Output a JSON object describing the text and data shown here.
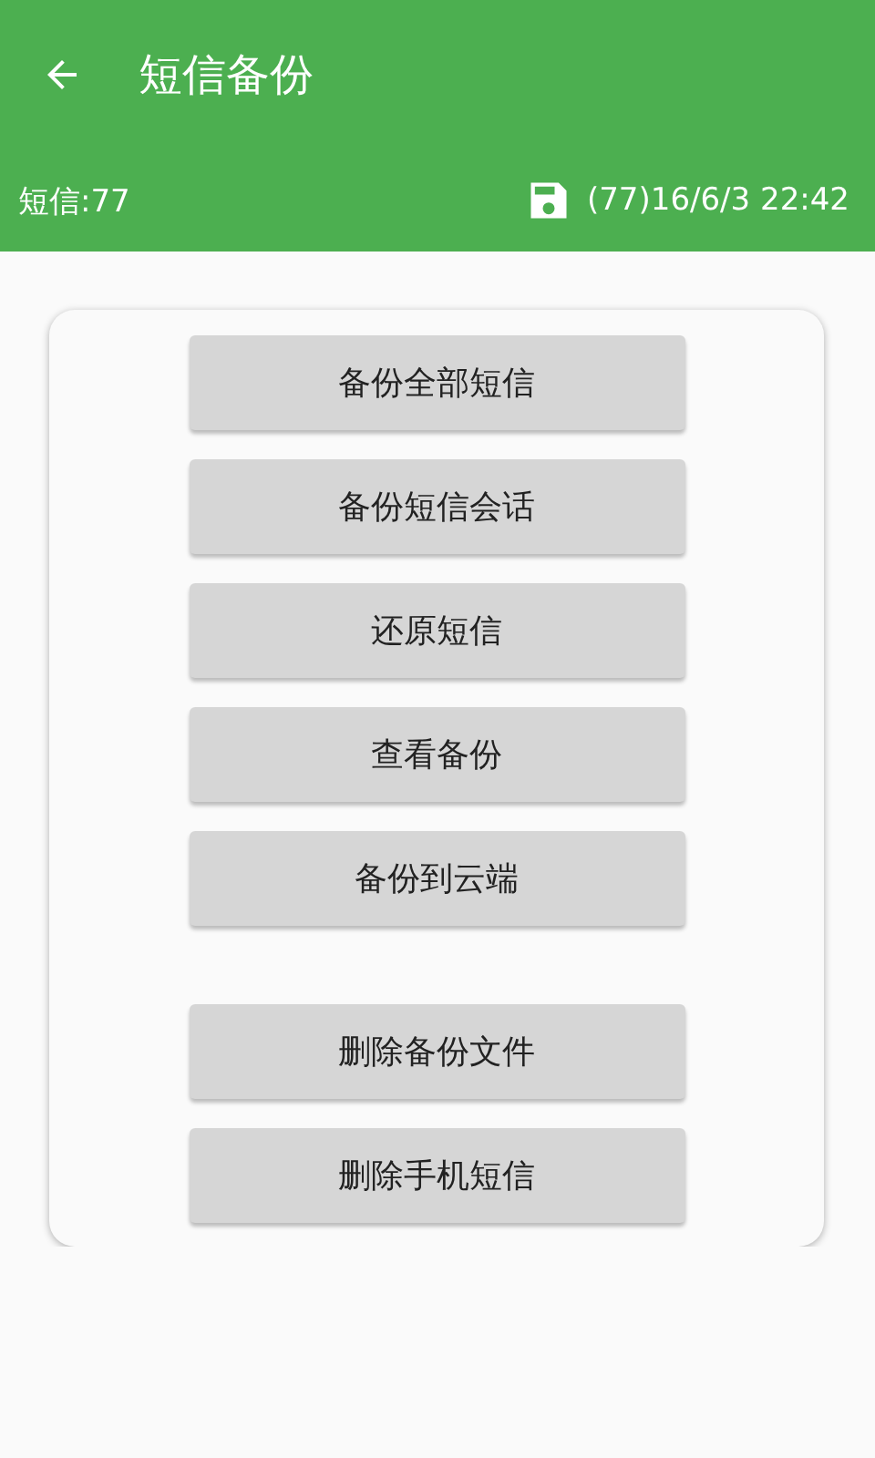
{
  "app_bar": {
    "title": "短信备份"
  },
  "info_bar": {
    "count": "短信:77",
    "last_backup": "(77)16/6/3 22:42"
  },
  "button_groups": [
    {
      "buttons": [
        "备份全部短信",
        "备份短信会话",
        "还原短信",
        "查看备份",
        "备份到云端"
      ]
    },
    {
      "buttons": [
        "删除备份文件",
        "删除手机短信"
      ]
    }
  ]
}
